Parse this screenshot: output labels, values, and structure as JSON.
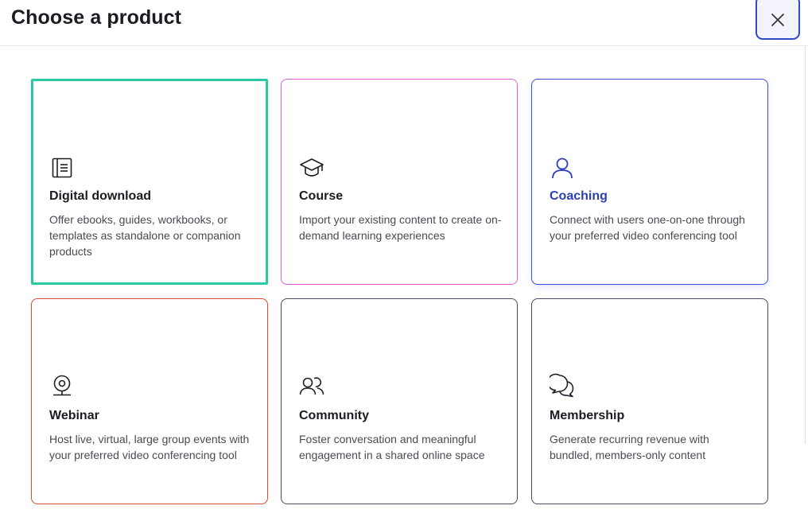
{
  "header": {
    "title": "Choose a product",
    "close_icon": "close-icon"
  },
  "products": [
    {
      "title": "Digital download",
      "description": "Offer ebooks, guides, workbooks, or templates as standalone or companion products",
      "icon": "notebook-icon",
      "border_color": "#2cc7a4",
      "state": "selected"
    },
    {
      "title": "Course",
      "description": "Import your existing content to create on-demand learning experiences",
      "icon": "graduation-cap-icon",
      "border_color": "#e45ed2"
    },
    {
      "title": "Coaching",
      "description": "Connect with users one-on-one through your preferred video conferencing tool",
      "icon": "user-icon",
      "border_color": "#3a52c9",
      "state": "hover"
    },
    {
      "title": "Webinar",
      "description": "Host live, virtual, large group events with your preferred video conferencing tool",
      "icon": "webcam-icon",
      "border_color": "#d24e2c"
    },
    {
      "title": "Community",
      "description": "Foster conversation and meaningful engagement in a shared online space",
      "icon": "users-icon",
      "border_color": "#4a4a66"
    },
    {
      "title": "Membership",
      "description": "Generate recurring revenue with bundled, members-only content",
      "icon": "chat-bubbles-icon",
      "border_color": "#4a4a66"
    }
  ]
}
